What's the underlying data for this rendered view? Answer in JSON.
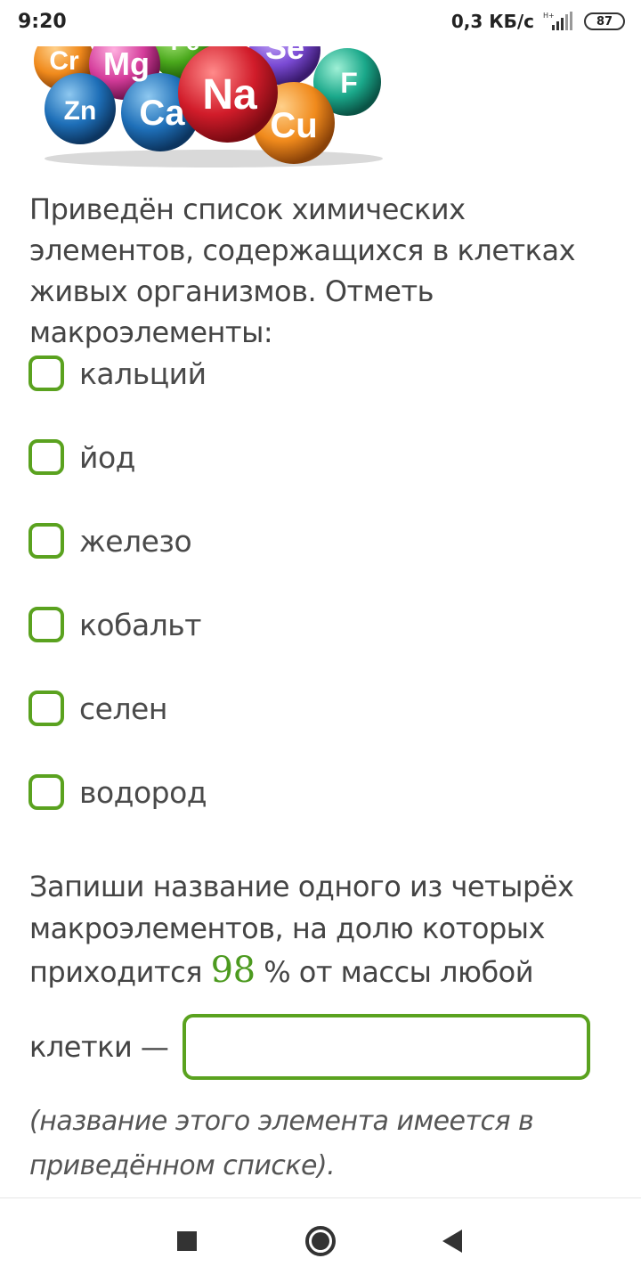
{
  "status_bar": {
    "time": "9:20",
    "net_speed": "0,3 КБ/с",
    "battery": "87"
  },
  "hero": {
    "elements": [
      "Cr",
      "Mg",
      "Fe",
      "Se",
      "Zn",
      "Ca",
      "Na",
      "Cu",
      "F"
    ]
  },
  "question": {
    "text": "Приведён список химических элементов, содержащихся в клетках живых организмов. Отметь макроэлементы:"
  },
  "options": [
    {
      "label": "кальций"
    },
    {
      "label": "йод"
    },
    {
      "label": "железо"
    },
    {
      "label": "кобальт"
    },
    {
      "label": "селен"
    },
    {
      "label": "водород"
    }
  ],
  "fill": {
    "text_before": "Запиши название одного из четырёх макроэлементов, на долю которых приходится ",
    "number": "98",
    "text_after": " % от массы любой",
    "answer_label": "клетки —",
    "answer_value": "",
    "hint": " (название этого элемента имеется в приведённом списке)."
  },
  "colors": {
    "accent": "#5aa21f",
    "text": "#444444"
  }
}
